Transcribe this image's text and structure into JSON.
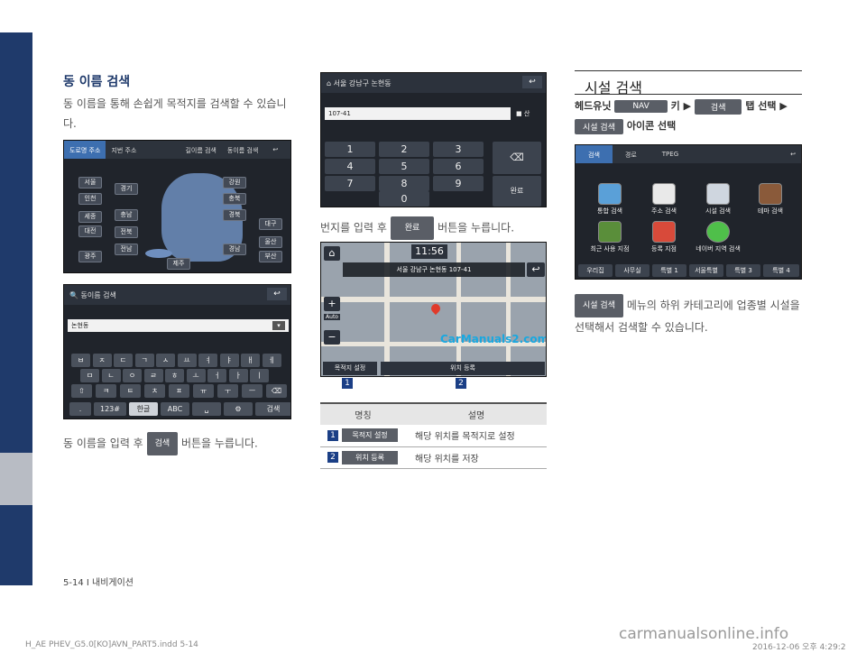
{
  "left_column": {
    "title": "동 이름 검색",
    "intro": "동 이름을 통해 손쉽게 목적지를 검색할 수 있습니다.",
    "map_screen": {
      "tabs": [
        "도로명 주소",
        "지번 주소",
        "길이름 검색",
        "동이름 검색"
      ],
      "regions_left": [
        "서울",
        "인천",
        "세종",
        "대전",
        "광주"
      ],
      "regions_mid": [
        "경기",
        "충남",
        "전북",
        "전남",
        "제주"
      ],
      "regions_right": [
        "강원",
        "충북",
        "경북",
        "대구",
        "경남",
        "울산",
        "부산"
      ]
    },
    "keyboard_screen": {
      "title": "동이름 검색",
      "input": "논현동",
      "row1": [
        "ㅂ",
        "ㅈ",
        "ㄷ",
        "ㄱ",
        "ㅅ",
        "ㅛ",
        "ㅕ",
        "ㅑ",
        "ㅐ",
        "ㅔ"
      ],
      "row2": [
        "ㅁ",
        "ㄴ",
        "ㅇ",
        "ㄹ",
        "ㅎ",
        "ㅗ",
        "ㅓ",
        "ㅏ",
        "ㅣ"
      ],
      "row3": [
        "⇧",
        "ㅋ",
        "ㅌ",
        "ㅊ",
        "ㅍ",
        "ㅠ",
        "ㅜ",
        "ㅡ",
        "⌫"
      ],
      "row4": [
        ".",
        "123#",
        "한글",
        "ABC",
        "␣",
        "⚙",
        "검색"
      ]
    },
    "caption_pre": "동 이름을 입력 후",
    "caption_chip": "검색",
    "caption_post": "버튼을 누릅니다."
  },
  "mid_column": {
    "numpad_screen": {
      "address": "서울 강남구 논현동",
      "input": "107-41",
      "checkbox": "산",
      "keys": [
        "1",
        "2",
        "3",
        "4",
        "5",
        "6",
        "7",
        "8",
        "9",
        "0"
      ],
      "done": "완료"
    },
    "caption_pre": "번지를 입력 후",
    "caption_chip": "완료",
    "caption_post": "버튼을 누릅니다.",
    "map_screen": {
      "time": "11:56",
      "address": "서울 강남구 논현동 107-41",
      "auto": "Auto",
      "btn_dest": "목적지 설정",
      "btn_reg": "위치 등록",
      "watermark": "CarManuals2.com"
    },
    "markers": [
      "1",
      "2"
    ],
    "table": {
      "header": [
        "명칭",
        "설명"
      ],
      "rows": [
        {
          "num": "1",
          "name": "목적지 설정",
          "desc": "해당 위치를 목적지로 설정"
        },
        {
          "num": "2",
          "name": "위치 등록",
          "desc": "해당 위치를 저장"
        }
      ]
    }
  },
  "right_column": {
    "title": "시설 검색",
    "step_pre": "헤드유닛",
    "nav_key": "NAV",
    "step_key": "키 ▶",
    "tab_chip": "검색",
    "step_tab": "탭 선택 ▶",
    "icon_chip": "시설 검색",
    "step_icon": "아이콘 선택",
    "facility_screen": {
      "tabs": [
        "검색",
        "경로",
        "TPEG"
      ],
      "icons": [
        "통합 검색",
        "주소 검색",
        "시설 검색",
        "테마 검색",
        "최근 사용 지점",
        "등록 지점",
        "네이버 지역 검색"
      ],
      "keys": [
        "우리집",
        "사무실",
        "특별 1",
        "서울특별",
        "특별 3",
        "특별 4"
      ]
    },
    "desc_chip": "시설 검색",
    "desc": "메뉴의 하위 카테고리에 업종별 시설을 선택해서 검색할 수 있습니다."
  },
  "footer": {
    "page": "5-14 I 내비게이션",
    "file": "H_AE PHEV_G5.0[KO]AVN_PART5.indd   5-14",
    "date": "2016-12-06   오후 4:29:2",
    "site": "carmanualsonline.info"
  }
}
